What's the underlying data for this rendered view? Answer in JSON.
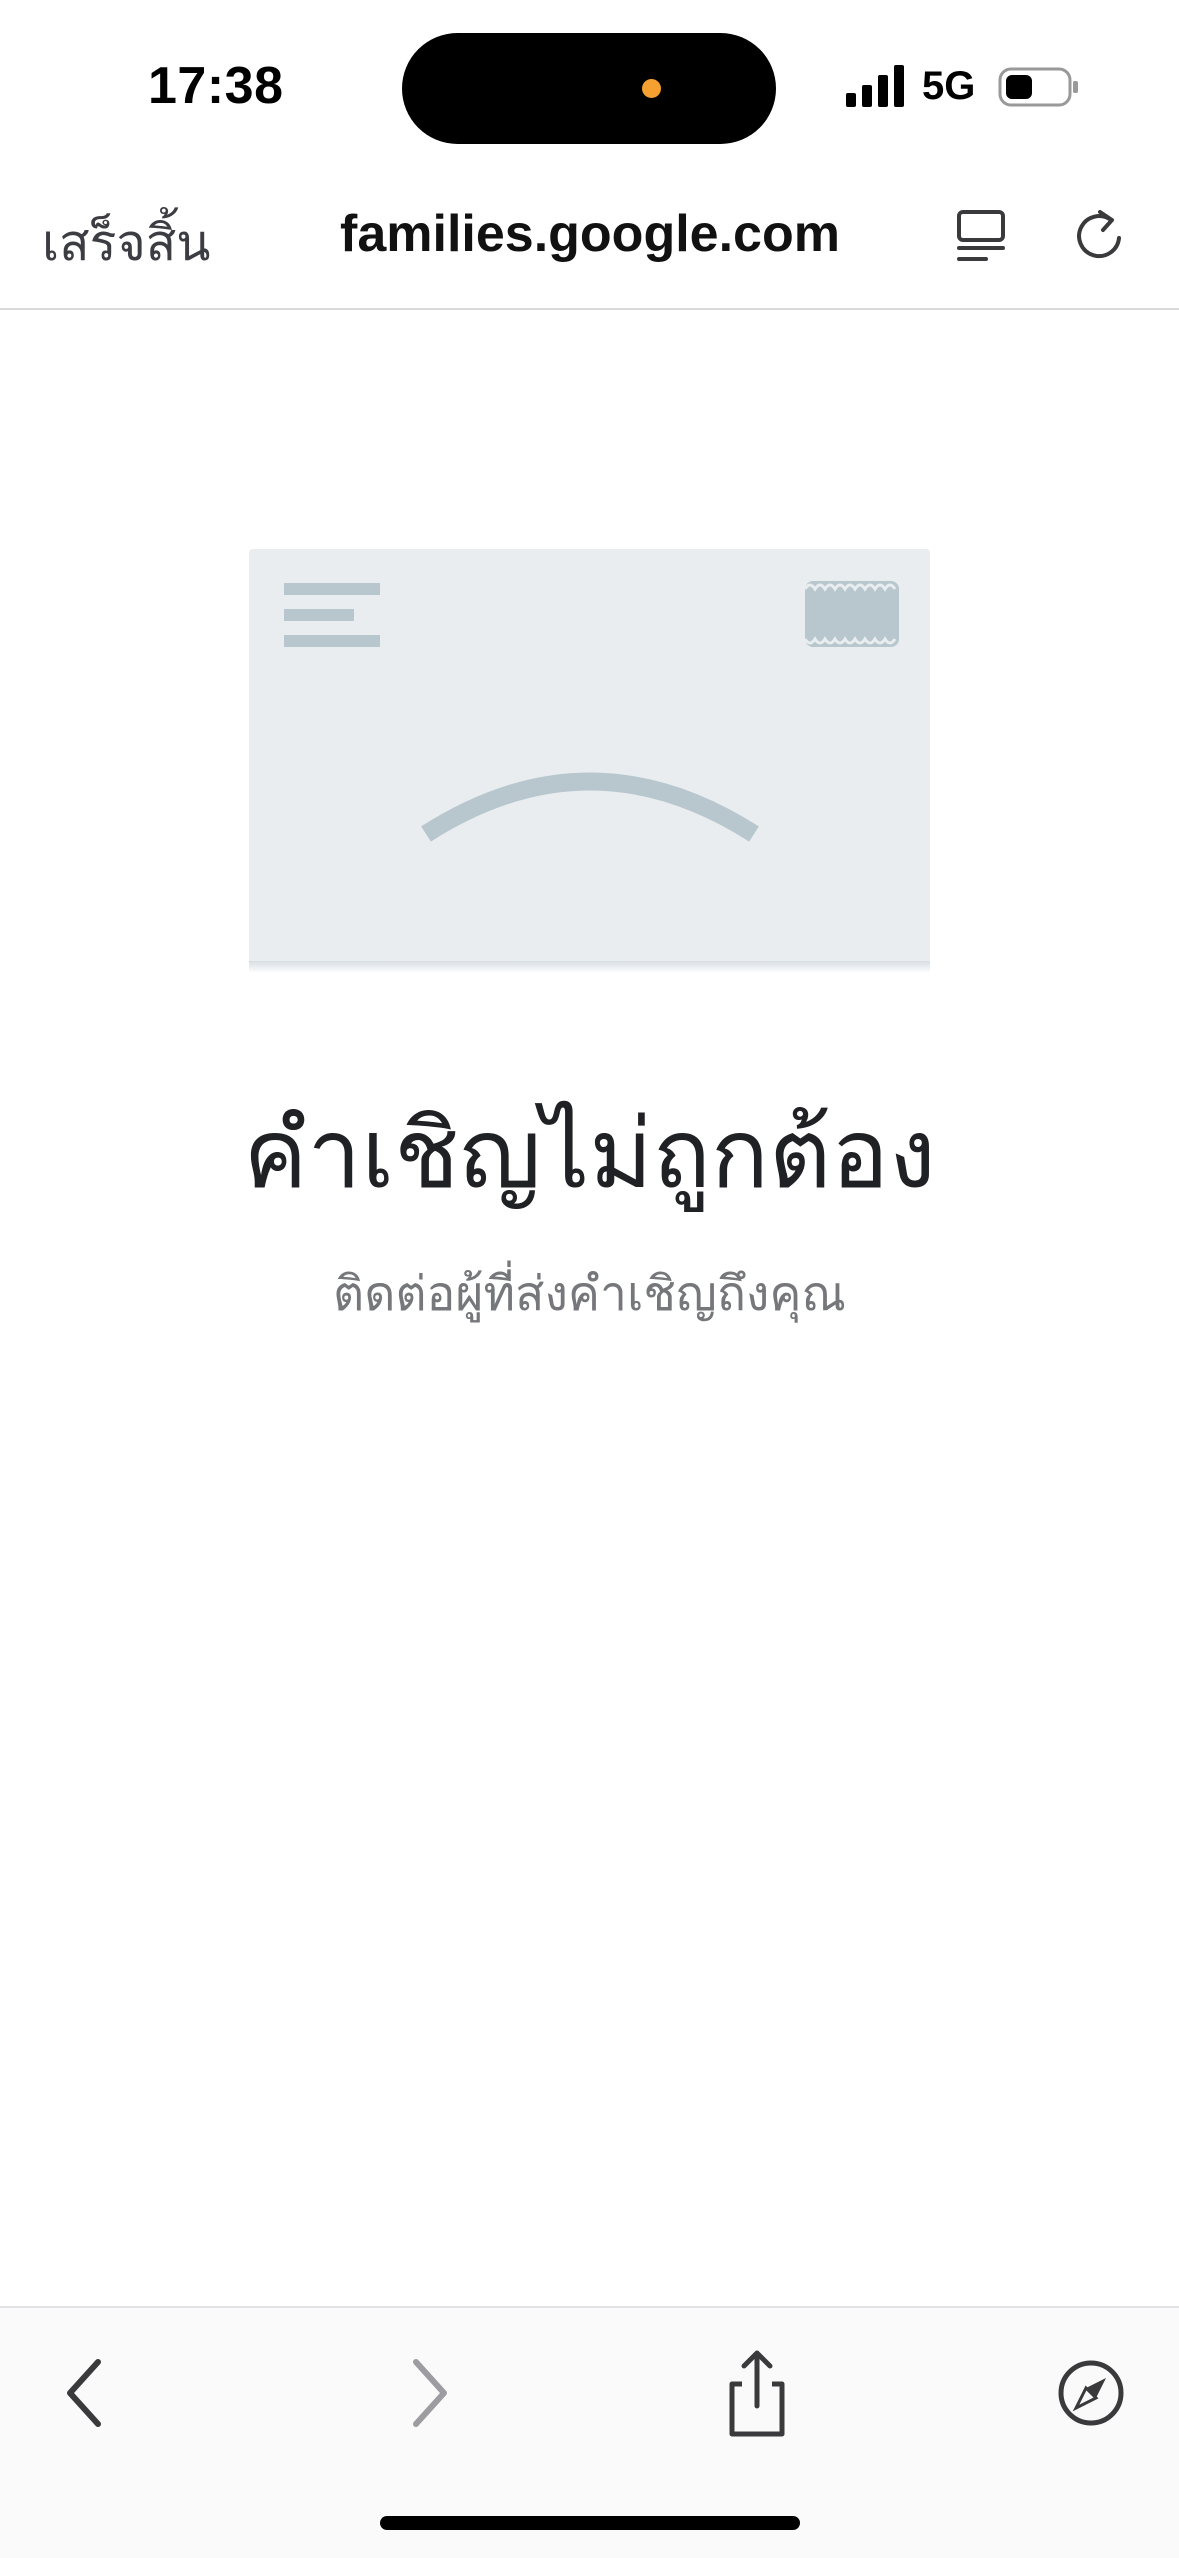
{
  "status_bar": {
    "time": "17:38",
    "network": "5G",
    "icons": [
      "signal-bars-icon",
      "battery-icon"
    ]
  },
  "browser": {
    "done_label": "เสร็จสิ้น",
    "domain": "families.google.com",
    "icons": [
      "reader-view-icon",
      "reload-icon"
    ]
  },
  "content": {
    "illustration": "envelope-sad-icon",
    "title": "คำเชิญไม่ถูกต้อง",
    "subtitle": "ติดต่อผู้ที่ส่งคำเชิญถึงคุณ"
  },
  "toolbar": {
    "icons": [
      "back-chevron-icon",
      "forward-chevron-icon",
      "share-icon",
      "compass-icon"
    ]
  },
  "colors": {
    "envelope_fill": "#e9edf0",
    "envelope_accent": "#b7c7cd",
    "title_text": "#202124",
    "subtitle_text": "#75777a",
    "island_dot": "#f5a030"
  }
}
